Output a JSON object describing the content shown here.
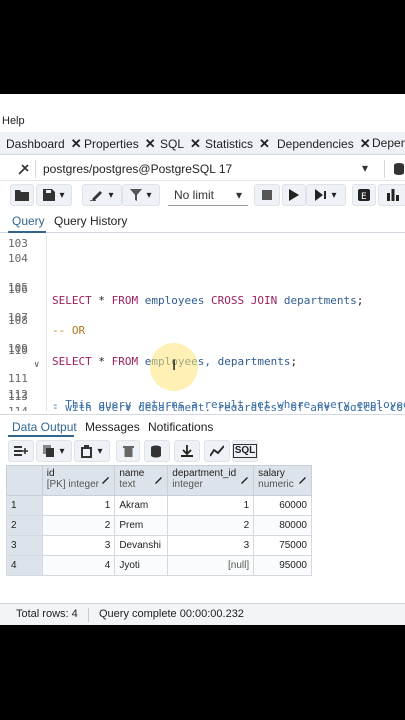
{
  "menu": {
    "help": "Help"
  },
  "tabs": [
    {
      "label": "Dashboard"
    },
    {
      "label": "Properties"
    },
    {
      "label": "SQL"
    },
    {
      "label": "Statistics"
    },
    {
      "label": "Dependencies"
    },
    {
      "label": "Depen"
    }
  ],
  "connection": {
    "label": "postgres/postgres@PostgreSQL 17"
  },
  "toolbar": {
    "limit": "No limit"
  },
  "query_tabs": {
    "query": "Query",
    "history": "Query History"
  },
  "editor": {
    "lines": [
      {
        "n": "103"
      },
      {
        "n": "104"
      },
      {
        "n": "105"
      },
      {
        "n": "106"
      },
      {
        "n": "107"
      },
      {
        "n": "108"
      },
      {
        "n": "109"
      },
      {
        "n": "110"
      },
      {
        "n": "111"
      },
      {
        "n": "112"
      },
      {
        "n": "113"
      },
      {
        "n": "114"
      }
    ],
    "l105": {
      "select": "SELECT",
      "star": " * ",
      "from": "FROM",
      "t1": " employees ",
      "cross": "CROSS JOIN",
      "t2": " departments",
      "semi": ";"
    },
    "l107": {
      "comment": "-- OR"
    },
    "l109": {
      "select": "SELECT",
      "star": " * ",
      "from": "FROM",
      "t1": " employees, departments",
      "semi": ";"
    },
    "l111": {
      "comment": "- This query returns a result set where every employee"
    },
    "l112": {
      "comment": "- with every department, regardless of any logical co"
    }
  },
  "output_tabs": {
    "data": "Data Output",
    "messages": "Messages",
    "notifications": "Notifications"
  },
  "results": {
    "columns": [
      {
        "name": "id",
        "type": "[PK] integer"
      },
      {
        "name": "name",
        "type": "text"
      },
      {
        "name": "department_id",
        "type": "integer"
      },
      {
        "name": "salary",
        "type": "numeric"
      }
    ],
    "rows": [
      {
        "num": "1",
        "id": "1",
        "name": "Akram",
        "dept": "1",
        "salary": "60000"
      },
      {
        "num": "2",
        "id": "2",
        "name": "Prem",
        "dept": "2",
        "salary": "80000"
      },
      {
        "num": "3",
        "id": "3",
        "name": "Devanshi",
        "dept": "3",
        "salary": "75000"
      },
      {
        "num": "4",
        "id": "4",
        "name": "Jyoti",
        "dept": "[null]",
        "salary": "95000"
      }
    ]
  },
  "status": {
    "rows": "Total rows: 4",
    "query": "Query complete 00:00:00.232"
  },
  "rtoolbar": {
    "sql": "SQL"
  }
}
